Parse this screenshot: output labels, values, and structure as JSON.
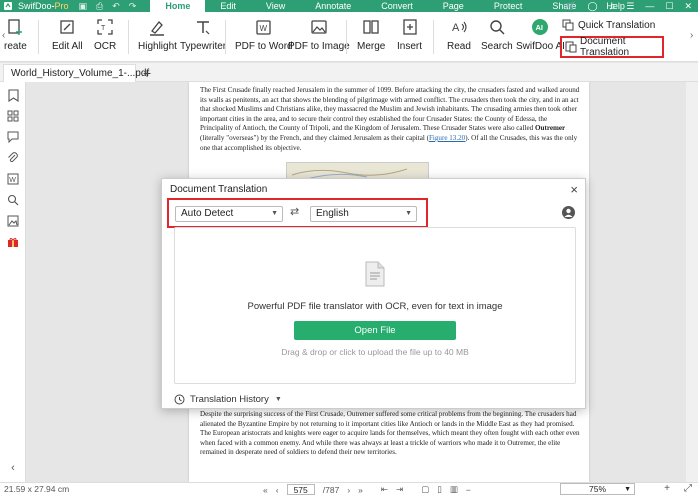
{
  "app": {
    "name": "SwifDoo",
    "edition": "Pro"
  },
  "menus": [
    "Home",
    "Edit",
    "View",
    "Annotate",
    "Convert",
    "Page",
    "Protect",
    "Share",
    "Help"
  ],
  "ribbon": {
    "items": [
      {
        "label": "reate",
        "icon": "create-icon"
      },
      {
        "label": "Edit All",
        "icon": "edit-all-icon"
      },
      {
        "label": "OCR",
        "icon": "ocr-icon"
      },
      {
        "label": "Highlight",
        "icon": "highlight-icon"
      },
      {
        "label": "Typewriter",
        "icon": "typewriter-icon"
      },
      {
        "label": "PDF to Word",
        "icon": "pdf-to-word-icon"
      },
      {
        "label": "PDF to Image",
        "icon": "pdf-to-image-icon"
      },
      {
        "label": "Merge",
        "icon": "merge-icon"
      },
      {
        "label": "Insert",
        "icon": "insert-icon"
      },
      {
        "label": "Read",
        "icon": "read-icon"
      },
      {
        "label": "Search",
        "icon": "search-icon"
      },
      {
        "label": "SwifDoo AI",
        "icon": "ai-icon"
      }
    ],
    "quick_translation": "Quick Translation",
    "document_translation": "Document Translation",
    "highlight_color": "#e0262a"
  },
  "tab": {
    "filename": "World_History_Volume_1-...pdf",
    "plus": "+"
  },
  "document": {
    "para1": "The First Crusade finally reached Jerusalem in the summer of 1099. Before attacking the city, the crusaders fasted and walked around its walls as penitents, an act that shows the blending of pilgrimage with armed conflict. The crusaders then took the city, and in an act that shocked Muslims and Christians alike, they massacred the Muslim and Jewish inhabitants. The crusading armies then took other important cities in the area, and to secure their control they established the four Crusader States: the County of Edessa, the Principality of Antioch, the County of Tripoli, and the Kingdom of Jerusalem. These Crusader States were also called",
    "para1_bold": "Outremer",
    "para1_mid": "(literally \"overseas\") by the French, and they claimed Jerusalem as their capital (",
    "para1_link": "Figure 13.20",
    "para1_end": "). Of all the Crusades, this was the only one that accomplished its objective.",
    "para2": "Despite the surprising success of the First Crusade, Outremer suffered some critical problems from the beginning. The crusaders had alienated the Byzantine Empire by not returning to it important cities like Antioch or lands in the Middle East as they had promised. The European aristocrats and knights were eager to acquire lands for themselves, which meant they often fought with each other even when faced with a common enemy. And while there was always at least a trickle of warriors who made it to Outremer, the elite remained in desperate need of soldiers to defend their new territories."
  },
  "modal": {
    "title": "Document Translation",
    "close": "×",
    "source_lang": "Auto Detect",
    "target_lang": "English",
    "swap_symbol": "⇄",
    "description": "Powerful PDF file translator with OCR, even for text in image",
    "open_button": "Open File",
    "drag_hint": "Drag & drop or click to upload the file up to 40 MB",
    "history": "Translation History"
  },
  "status": {
    "dims": "21.59 x 27.94 cm",
    "page": "575",
    "total": "/787",
    "zoom": "75%"
  }
}
